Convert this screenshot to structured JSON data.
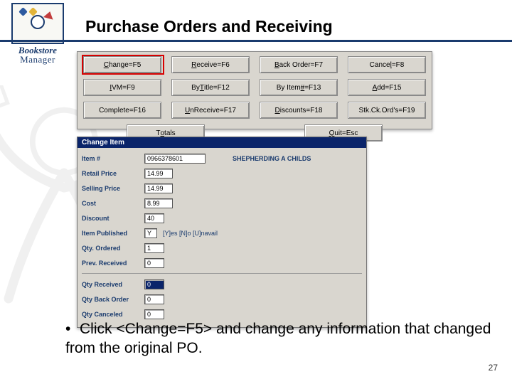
{
  "logo": {
    "line1": "Bookstore",
    "line2": "Manager"
  },
  "title": "Purchase Orders and Receiving",
  "buttons": {
    "r1": [
      {
        "html": "<span class='u'>C</span>hange=F5"
      },
      {
        "html": "<span class='u'>R</span>eceive=F6"
      },
      {
        "html": "<span class='u'>B</span>ack Order=F7"
      },
      {
        "html": "Cance<span class='u'>l</span>=F8"
      }
    ],
    "r2": [
      {
        "html": "<span class='u'>I</span>VM=F9"
      },
      {
        "html": "By <span class='u'>T</span>itle=F12"
      },
      {
        "html": "By Item <span class='u'>#</span>=F13"
      },
      {
        "html": "<span class='u'>A</span>dd=F15"
      }
    ],
    "r3": [
      {
        "html": "Complete=F16"
      },
      {
        "html": "<span class='u'>U</span>nReceive=F17"
      },
      {
        "html": "<span class='u'>D</span>iscounts=F18"
      },
      {
        "html": "Stk.Ck.Ord's=F19"
      }
    ],
    "r4": [
      {
        "html": "T<span class='u'>o</span>tals"
      },
      {
        "html": "<span class='u'>Q</span>uit=Esc"
      }
    ]
  },
  "form": {
    "title": "Change Item",
    "item_no_label": "Item #",
    "item_no": "0966378601",
    "item_desc": "SHEPHERDING A CHILDS",
    "retail_label": "Retail Price",
    "retail": "14.99",
    "selling_label": "Selling Price",
    "selling": "14.99",
    "cost_label": "Cost",
    "cost": "8.99",
    "discount_label": "Discount",
    "discount": "40",
    "pub_label": "Item Published",
    "pub": "Y",
    "pub_hint": "[Y]es [N]o [U]navail",
    "qty_ord_label": "Qty. Ordered",
    "qty_ord": "1",
    "prev_rec_label": "Prev. Received",
    "prev_rec": "0",
    "qty_rec_label": "Qty Received",
    "qty_rec": "0",
    "qty_bo_label": "Qty Back Order",
    "qty_bo": "0",
    "qty_can_label": "Qty Canceled",
    "qty_can": "0"
  },
  "bullet": "Click <Change=F5> and change any information that changed from the original PO.",
  "page": "27"
}
